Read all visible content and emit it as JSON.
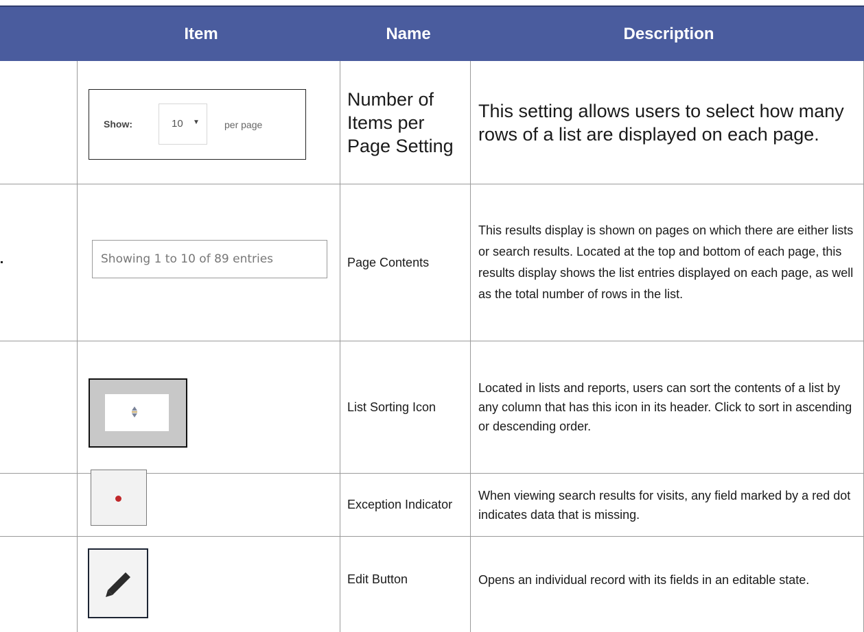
{
  "header": {
    "item": "Item",
    "name": "Name",
    "description": "Description"
  },
  "rows": [
    {
      "name": "Number of Items per Page Setting",
      "description": "This setting allows users to select how many rows of a list are displayed on each page.",
      "illustration": {
        "show_label": "Show:",
        "select_value": "10",
        "per_page_label": "per page"
      }
    },
    {
      "name": "Page Contents",
      "description": "This results display is shown on pages on which there are either lists or search results. Located at the top and bottom of each page, this results display shows the list entries displayed on each page, as well as the total number of rows in the list.",
      "illustration": {
        "text": "Showing 1 to 10 of 89 entries"
      }
    },
    {
      "name": "List Sorting Icon",
      "description": "Located in lists and reports, users can sort the contents of a list by any column that has this icon in its header. Click to sort in ascending or descending order.",
      "illustration": {
        "icon": "sort-icon"
      }
    },
    {
      "name": "Exception Indicator",
      "description": "When viewing search results for visits, any field marked by a red dot indicates data that is missing.",
      "illustration": {
        "icon": "red-dot-icon",
        "color": "#c0282b"
      }
    },
    {
      "name": "Edit Button",
      "description": "Opens an individual record with its fields in an editable state.",
      "illustration": {
        "icon": "pencil-icon"
      }
    }
  ],
  "colors": {
    "header_bg": "#4a5c9e",
    "header_text": "#ffffff",
    "grid": "#9a9a9a"
  }
}
